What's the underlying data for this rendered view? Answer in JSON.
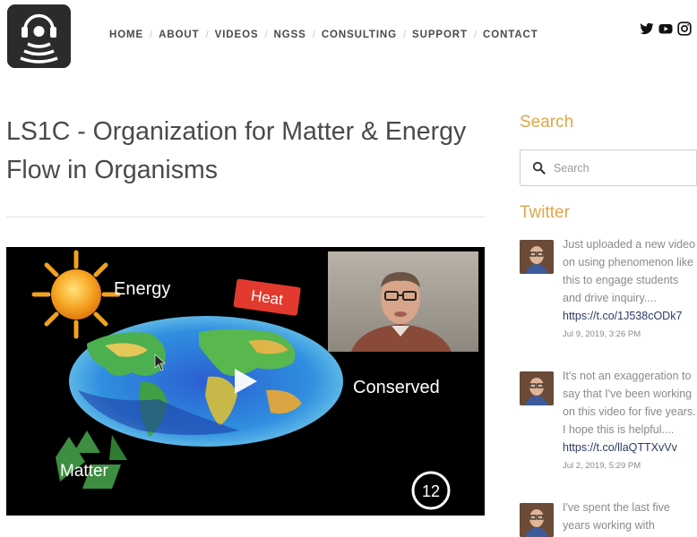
{
  "header": {
    "nav": [
      {
        "label": "HOME"
      },
      {
        "label": "ABOUT"
      },
      {
        "label": "VIDEOS"
      },
      {
        "label": "NGSS"
      },
      {
        "label": "CONSULTING"
      },
      {
        "label": "SUPPORT"
      },
      {
        "label": "CONTACT"
      }
    ],
    "social": [
      "twitter-icon",
      "youtube-icon",
      "instagram-icon"
    ]
  },
  "main": {
    "title": "LS1C - Organization for Matter & Energy Flow in Organisms",
    "video": {
      "labels": {
        "energy": "Energy",
        "heat": "Heat",
        "conserved": "Conserved",
        "matter": "Matter",
        "number": "12"
      }
    }
  },
  "sidebar": {
    "search": {
      "heading": "Search",
      "placeholder": "Search"
    },
    "twitter": {
      "heading": "Twitter",
      "tweets": [
        {
          "text": "Just uploaded a new video on using phenomenon like this to engage students and drive inquiry....",
          "link": "https://t.co/1J538cODk7",
          "date": "Jul 9, 2019, 3:26 PM"
        },
        {
          "text": "It's not an exaggeration to say that I've been working on this video for five years. I hope this is helpful....",
          "link": "https://t.co/llaQTTXvVv",
          "date": "Jul 2, 2019, 5:29 PM"
        },
        {
          "text": "I've spent the last five years working with",
          "link": "",
          "date": ""
        }
      ]
    }
  },
  "colors": {
    "accent": "#e0a64a",
    "link": "#2c3b66",
    "nav": "#4a4a4a"
  }
}
